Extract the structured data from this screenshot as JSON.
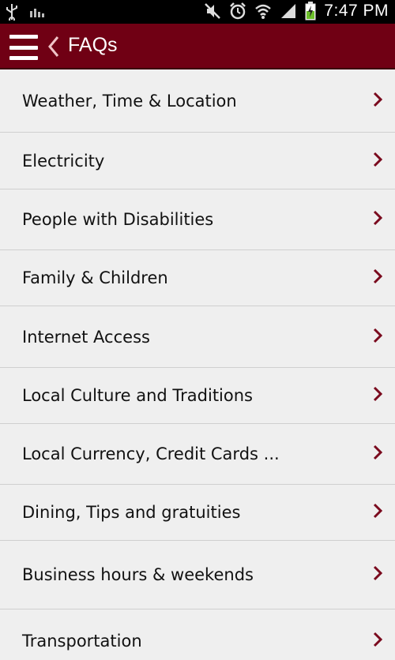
{
  "status_bar": {
    "time": "7:47 PM",
    "icons": [
      "usb-icon",
      "signal-bars-small-icon",
      "mute-icon",
      "alarm-icon",
      "wifi-icon",
      "cell-signal-icon",
      "battery-charging-icon"
    ]
  },
  "app_bar": {
    "title": "FAQs",
    "menu_icon": "hamburger-menu-icon",
    "back_icon": "chevron-left-icon",
    "color": "#700014"
  },
  "faq_items": [
    {
      "label": "Weather, Time & Location"
    },
    {
      "label": "Electricity"
    },
    {
      "label": "People with Disabilities"
    },
    {
      "label": "Family & Children"
    },
    {
      "label": "Internet Access"
    },
    {
      "label": "Local Culture and Traditions"
    },
    {
      "label": "Local Currency, Credit Cards ..."
    },
    {
      "label": "Dining, Tips and gratuities"
    },
    {
      "label": "Business hours & weekends"
    },
    {
      "label": "Transportation"
    }
  ],
  "accent_color": "#7a0a1e"
}
